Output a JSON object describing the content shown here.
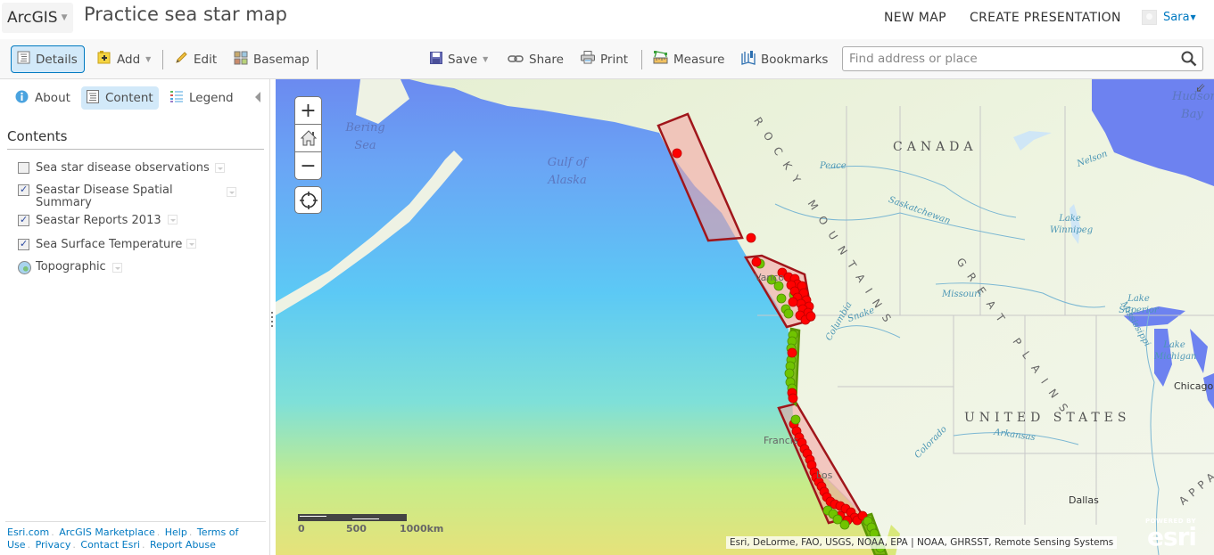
{
  "header": {
    "app_name": "ArcGIS",
    "map_title": "Practice sea star map",
    "new_map": "NEW MAP",
    "create_presentation": "CREATE PRESENTATION",
    "user_name": "Sara"
  },
  "toolbar": {
    "details": "Details",
    "add": "Add",
    "edit": "Edit",
    "basemap": "Basemap",
    "save": "Save",
    "share": "Share",
    "print": "Print",
    "measure": "Measure",
    "bookmarks": "Bookmarks",
    "search_placeholder": "Find address or place"
  },
  "panel": {
    "tabs": {
      "about": "About",
      "content": "Content",
      "legend": "Legend"
    },
    "contents_title": "Contents",
    "layers": [
      {
        "label": "Sea star disease observations",
        "checked": false,
        "type": "checkbox"
      },
      {
        "label": "Seastar Disease Spatial Summary",
        "checked": true,
        "type": "checkbox"
      },
      {
        "label": "Seastar Reports 2013",
        "checked": true,
        "type": "checkbox"
      },
      {
        "label": "Sea Surface Temperature",
        "checked": true,
        "type": "checkbox"
      },
      {
        "label": "Topographic",
        "checked": null,
        "type": "basemap"
      }
    ],
    "footer": {
      "esri": "Esri.com",
      "marketplace": "ArcGIS Marketplace",
      "help": "Help",
      "terms": "Terms of Use",
      "privacy": "Privacy",
      "contact": "Contact Esri",
      "report": "Report Abuse"
    }
  },
  "map": {
    "labels": {
      "bering_sea": "Bering Sea",
      "gulf_of_alaska": "Gulf of Alaska",
      "hudson_bay": "Hudson Bay",
      "canada": "CANADA",
      "united_states": "UNITED STATES",
      "rocky_mountains": "ROCKY MOUNTAINS",
      "great_plains": "GREAT PLAINS",
      "appalachian": "APPA",
      "lake_winnipeg": "Lake Winnipeg",
      "lake_superior": "Lake Superior",
      "lake_michigan": "Lake Michigan",
      "peace": "Peace",
      "nelson": "Nelson",
      "saskatchewan": "Saskatchewan",
      "missouri": "Missouri",
      "mississippi": "Mississippi",
      "arkansas": "Arkansas",
      "columbia": "Columbia",
      "snake": "Snake",
      "colorado": "Colorado",
      "chicago": "Chicago",
      "dallas": "Dallas",
      "vancouver": "Vanco",
      "san_francisco": "Francis",
      "los_angeles": "Los"
    },
    "scale": {
      "zero": "0",
      "mid": "500",
      "end": "1000km"
    },
    "attribution": "Esri, DeLorme, FAO, USGS, NOAA, EPA | NOAA, GHRSST, Remote Sensing Systems",
    "powered_by": "POWERED BY",
    "esri_logo": "esri",
    "colors": {
      "disease_point": "#ff0000",
      "healthy_point": "#70c400",
      "summary_polygon_stroke": "#a0161b",
      "summary_polygon_fill": "#f4a0a0",
      "healthy_polygon_fill": "#70b000"
    }
  }
}
